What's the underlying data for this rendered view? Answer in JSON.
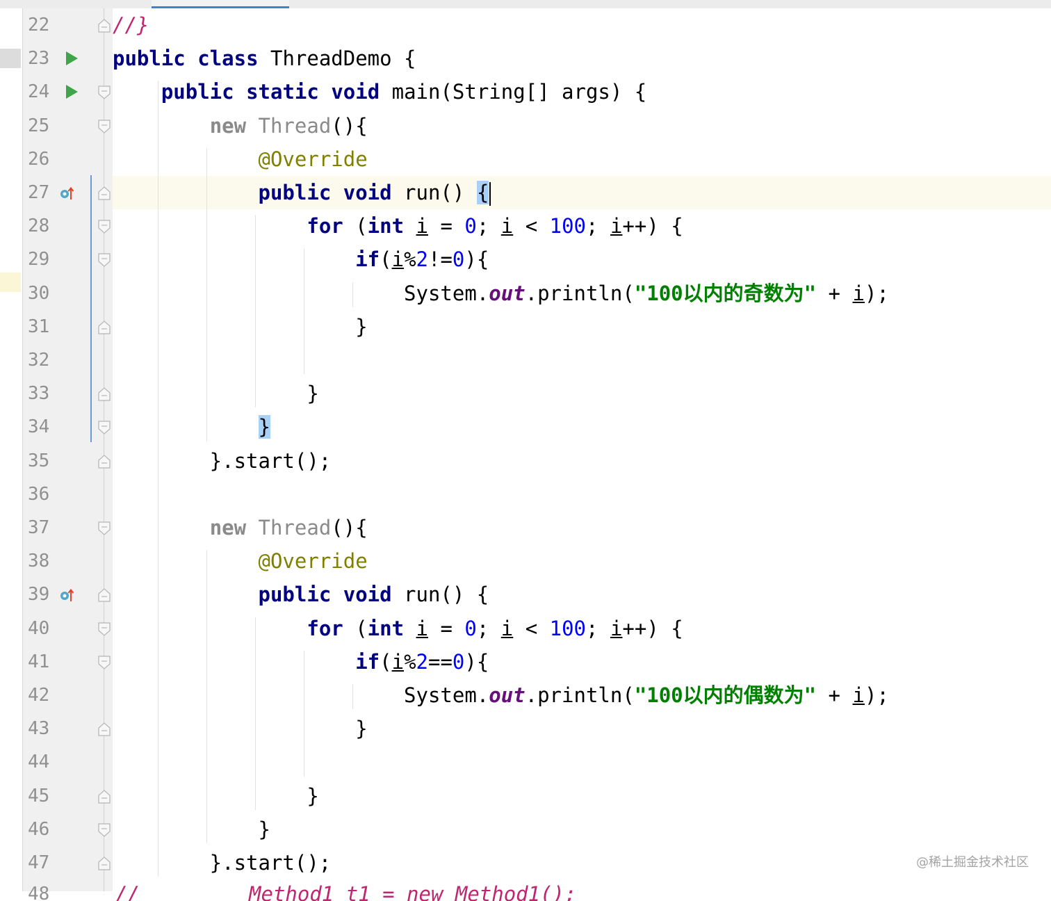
{
  "editor": {
    "lines": [
      {
        "num": "22",
        "run": false,
        "override": false,
        "fold": "end",
        "segs": [
          {
            "c": "cmt",
            "t": "//}"
          }
        ]
      },
      {
        "num": "23",
        "run": true,
        "override": false,
        "fold": "",
        "segs": [
          {
            "c": "kw",
            "t": "public"
          },
          {
            "c": "",
            "t": " "
          },
          {
            "c": "kw",
            "t": "class"
          },
          {
            "c": "",
            "t": " ThreadDemo {"
          }
        ]
      },
      {
        "num": "24",
        "run": true,
        "override": false,
        "fold": "start",
        "segs": [
          {
            "c": "",
            "t": "    "
          },
          {
            "c": "kw",
            "t": "public"
          },
          {
            "c": "",
            "t": " "
          },
          {
            "c": "kw",
            "t": "static"
          },
          {
            "c": "",
            "t": " "
          },
          {
            "c": "kw",
            "t": "void"
          },
          {
            "c": "",
            "t": " main(String[] args) {"
          }
        ]
      },
      {
        "num": "25",
        "run": false,
        "override": false,
        "fold": "start",
        "segs": [
          {
            "c": "",
            "t": "        "
          },
          {
            "c": "kw muted",
            "t": "new"
          },
          {
            "c": "muted",
            "t": " Thread"
          },
          {
            "c": "",
            "t": "(){"
          }
        ]
      },
      {
        "num": "26",
        "run": false,
        "override": false,
        "fold": "",
        "segs": [
          {
            "c": "",
            "t": "            "
          },
          {
            "c": "ann",
            "t": "@Override"
          }
        ]
      },
      {
        "num": "27",
        "run": false,
        "override": true,
        "fold": "end",
        "current": true,
        "segs": [
          {
            "c": "",
            "t": "            "
          },
          {
            "c": "kw",
            "t": "public"
          },
          {
            "c": "",
            "t": " "
          },
          {
            "c": "kw",
            "t": "void"
          },
          {
            "c": "",
            "t": " run() "
          },
          {
            "c": "brace-hl",
            "t": "{"
          },
          {
            "c": "caret",
            "t": ""
          }
        ]
      },
      {
        "num": "28",
        "run": false,
        "override": false,
        "fold": "start",
        "segs": [
          {
            "c": "",
            "t": "                "
          },
          {
            "c": "kw",
            "t": "for"
          },
          {
            "c": "",
            "t": " ("
          },
          {
            "c": "kw",
            "t": "int"
          },
          {
            "c": "",
            "t": " "
          },
          {
            "c": "ul",
            "t": "i"
          },
          {
            "c": "",
            "t": " = "
          },
          {
            "c": "num",
            "t": "0"
          },
          {
            "c": "",
            "t": "; "
          },
          {
            "c": "ul",
            "t": "i"
          },
          {
            "c": "",
            "t": " < "
          },
          {
            "c": "num",
            "t": "100"
          },
          {
            "c": "",
            "t": "; "
          },
          {
            "c": "ul",
            "t": "i"
          },
          {
            "c": "",
            "t": "++) {"
          }
        ]
      },
      {
        "num": "29",
        "run": false,
        "override": false,
        "fold": "start",
        "segs": [
          {
            "c": "",
            "t": "                    "
          },
          {
            "c": "kw",
            "t": "if"
          },
          {
            "c": "",
            "t": "("
          },
          {
            "c": "ul",
            "t": "i"
          },
          {
            "c": "",
            "t": "%"
          },
          {
            "c": "num",
            "t": "2"
          },
          {
            "c": "",
            "t": "!="
          },
          {
            "c": "num",
            "t": "0"
          },
          {
            "c": "",
            "t": "){"
          }
        ]
      },
      {
        "num": "30",
        "run": false,
        "override": false,
        "fold": "",
        "segs": [
          {
            "c": "",
            "t": "                        System."
          },
          {
            "c": "stat",
            "t": "out"
          },
          {
            "c": "",
            "t": ".println("
          },
          {
            "c": "str",
            "t": "\"100以内的奇数为\""
          },
          {
            "c": "",
            "t": " + "
          },
          {
            "c": "ul",
            "t": "i"
          },
          {
            "c": "",
            "t": ");"
          }
        ]
      },
      {
        "num": "31",
        "run": false,
        "override": false,
        "fold": "end",
        "segs": [
          {
            "c": "",
            "t": "                    }"
          }
        ]
      },
      {
        "num": "32",
        "run": false,
        "override": false,
        "fold": "",
        "segs": []
      },
      {
        "num": "33",
        "run": false,
        "override": false,
        "fold": "end",
        "segs": [
          {
            "c": "",
            "t": "                }"
          }
        ]
      },
      {
        "num": "34",
        "run": false,
        "override": false,
        "fold": "start",
        "segs": [
          {
            "c": "",
            "t": "            "
          },
          {
            "c": "brace-hl",
            "t": "}"
          }
        ]
      },
      {
        "num": "35",
        "run": false,
        "override": false,
        "fold": "end",
        "segs": [
          {
            "c": "",
            "t": "        }.start();"
          }
        ]
      },
      {
        "num": "36",
        "run": false,
        "override": false,
        "fold": "",
        "segs": []
      },
      {
        "num": "37",
        "run": false,
        "override": false,
        "fold": "start",
        "segs": [
          {
            "c": "",
            "t": "        "
          },
          {
            "c": "kw muted",
            "t": "new"
          },
          {
            "c": "muted",
            "t": " Thread"
          },
          {
            "c": "",
            "t": "(){"
          }
        ]
      },
      {
        "num": "38",
        "run": false,
        "override": false,
        "fold": "",
        "segs": [
          {
            "c": "",
            "t": "            "
          },
          {
            "c": "ann",
            "t": "@Override"
          }
        ]
      },
      {
        "num": "39",
        "run": false,
        "override": true,
        "fold": "end",
        "segs": [
          {
            "c": "",
            "t": "            "
          },
          {
            "c": "kw",
            "t": "public"
          },
          {
            "c": "",
            "t": " "
          },
          {
            "c": "kw",
            "t": "void"
          },
          {
            "c": "",
            "t": " run() {"
          }
        ]
      },
      {
        "num": "40",
        "run": false,
        "override": false,
        "fold": "start",
        "segs": [
          {
            "c": "",
            "t": "                "
          },
          {
            "c": "kw",
            "t": "for"
          },
          {
            "c": "",
            "t": " ("
          },
          {
            "c": "kw",
            "t": "int"
          },
          {
            "c": "",
            "t": " "
          },
          {
            "c": "ul",
            "t": "i"
          },
          {
            "c": "",
            "t": " = "
          },
          {
            "c": "num",
            "t": "0"
          },
          {
            "c": "",
            "t": "; "
          },
          {
            "c": "ul",
            "t": "i"
          },
          {
            "c": "",
            "t": " < "
          },
          {
            "c": "num",
            "t": "100"
          },
          {
            "c": "",
            "t": "; "
          },
          {
            "c": "ul",
            "t": "i"
          },
          {
            "c": "",
            "t": "++) {"
          }
        ]
      },
      {
        "num": "41",
        "run": false,
        "override": false,
        "fold": "start",
        "segs": [
          {
            "c": "",
            "t": "                    "
          },
          {
            "c": "kw",
            "t": "if"
          },
          {
            "c": "",
            "t": "("
          },
          {
            "c": "ul",
            "t": "i"
          },
          {
            "c": "",
            "t": "%"
          },
          {
            "c": "num",
            "t": "2"
          },
          {
            "c": "",
            "t": "=="
          },
          {
            "c": "num",
            "t": "0"
          },
          {
            "c": "",
            "t": "){"
          }
        ]
      },
      {
        "num": "42",
        "run": false,
        "override": false,
        "fold": "",
        "segs": [
          {
            "c": "",
            "t": "                        System."
          },
          {
            "c": "stat",
            "t": "out"
          },
          {
            "c": "",
            "t": ".println("
          },
          {
            "c": "str",
            "t": "\"100以内的偶数为\""
          },
          {
            "c": "",
            "t": " + "
          },
          {
            "c": "ul",
            "t": "i"
          },
          {
            "c": "",
            "t": ");"
          }
        ]
      },
      {
        "num": "43",
        "run": false,
        "override": false,
        "fold": "end",
        "segs": [
          {
            "c": "",
            "t": "                    }"
          }
        ]
      },
      {
        "num": "44",
        "run": false,
        "override": false,
        "fold": "",
        "segs": []
      },
      {
        "num": "45",
        "run": false,
        "override": false,
        "fold": "end",
        "segs": [
          {
            "c": "",
            "t": "                }"
          }
        ]
      },
      {
        "num": "46",
        "run": false,
        "override": false,
        "fold": "start",
        "segs": [
          {
            "c": "",
            "t": "            }"
          }
        ]
      },
      {
        "num": "47",
        "run": false,
        "override": false,
        "fold": "end",
        "segs": [
          {
            "c": "",
            "t": "        }.start();"
          }
        ]
      }
    ],
    "partial_last_line": {
      "num": "48",
      "text": "//         Method1 t1 = new Method1();"
    }
  },
  "watermark": "@稀土掘金技术社区",
  "colors": {
    "keyword": "#000080",
    "number": "#0000ff",
    "string": "#008000",
    "annotation": "#808000",
    "comment": "#c02670",
    "run_icon": "#3ea64a",
    "current_line": "#fcfaed",
    "brace_match": "#a9d1f7"
  }
}
